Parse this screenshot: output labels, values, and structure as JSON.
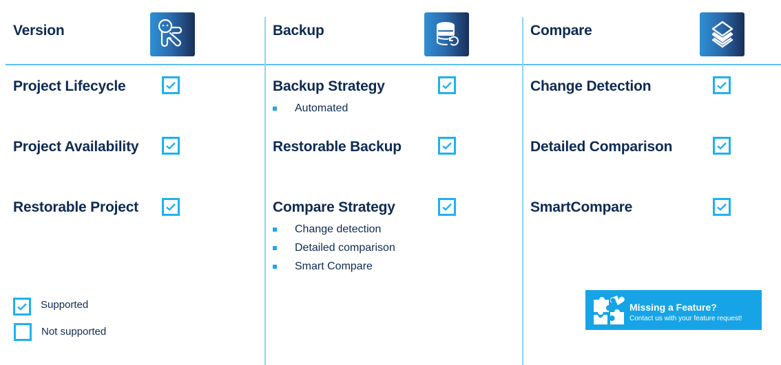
{
  "columns": [
    {
      "title": "Version",
      "icon": "octopus-version-icon",
      "features": [
        {
          "label": "Project Lifecycle",
          "supported": true,
          "bullets": []
        },
        {
          "label": "Project Availability",
          "supported": true,
          "bullets": []
        },
        {
          "label": "Restorable Project",
          "supported": true,
          "bullets": []
        }
      ]
    },
    {
      "title": "Backup",
      "icon": "database-backup-icon",
      "features": [
        {
          "label": "Backup Strategy",
          "supported": true,
          "bullets": [
            "Automated"
          ]
        },
        {
          "label": "Restorable Backup",
          "supported": true,
          "bullets": []
        },
        {
          "label": "Compare Strategy",
          "supported": true,
          "bullets": [
            "Change detection",
            "Detailed comparison",
            "Smart Compare"
          ]
        }
      ]
    },
    {
      "title": "Compare",
      "icon": "layers-compare-icon",
      "features": [
        {
          "label": "Change Detection",
          "supported": true,
          "bullets": []
        },
        {
          "label": "Detailed Comparison",
          "supported": true,
          "bullets": []
        },
        {
          "label": "SmartCompare",
          "supported": true,
          "bullets": []
        }
      ]
    }
  ],
  "legend": {
    "supported": "Supported",
    "not_supported": "Not supported"
  },
  "banner": {
    "title": "Missing a Feature?",
    "subtitle": "Contact us with your feature request!",
    "icon": "puzzle-icon"
  },
  "colors": {
    "accent": "#1fb1ee",
    "text": "#0e2a52",
    "divider": "#5cc0f2",
    "banner": "#16a4e6"
  }
}
